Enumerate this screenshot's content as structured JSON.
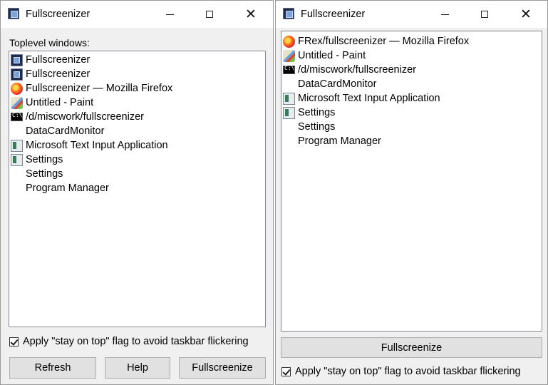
{
  "left_window": {
    "title": "Fullscreenizer",
    "list_label": "Toplevel windows:",
    "items": [
      {
        "icon": "fullscreenizer-icon",
        "label": "Fullscreenizer"
      },
      {
        "icon": "fullscreenizer-icon",
        "label": "Fullscreenizer"
      },
      {
        "icon": "firefox-icon",
        "label": "Fullscreenizer — Mozilla Firefox"
      },
      {
        "icon": "paint-icon",
        "label": "Untitled - Paint"
      },
      {
        "icon": "command-prompt-icon",
        "label": "/d/miscwork/fullscreenizer"
      },
      {
        "icon": "none",
        "label": "DataCardMonitor"
      },
      {
        "icon": "ms-app-icon",
        "label": "Microsoft Text Input Application"
      },
      {
        "icon": "ms-app-icon",
        "label": "Settings"
      },
      {
        "icon": "none",
        "label": "Settings"
      },
      {
        "icon": "none",
        "label": "Program Manager"
      }
    ],
    "checkbox_label": "Apply \"stay on top\" flag to avoid taskbar flickering",
    "checkbox_checked": true,
    "buttons": {
      "refresh": "Refresh",
      "help": "Help",
      "fullscreenize": "Fullscreenize"
    }
  },
  "right_window": {
    "title": "Fullscreenizer",
    "items": [
      {
        "icon": "firefox-icon",
        "label": "FRex/fullscreenizer — Mozilla Firefox"
      },
      {
        "icon": "paint-icon",
        "label": "Untitled - Paint"
      },
      {
        "icon": "command-prompt-icon",
        "label": "/d/miscwork/fullscreenizer"
      },
      {
        "icon": "none",
        "label": "DataCardMonitor"
      },
      {
        "icon": "ms-app-icon",
        "label": "Microsoft Text Input Application"
      },
      {
        "icon": "ms-app-icon",
        "label": "Settings"
      },
      {
        "icon": "none",
        "label": "Settings"
      },
      {
        "icon": "none",
        "label": "Program Manager"
      }
    ],
    "fullscreenize_button": "Fullscreenize",
    "checkbox_label": "Apply \"stay on top\" flag to avoid taskbar flickering",
    "checkbox_checked": true
  },
  "titlebar_buttons": {
    "minimize": "–",
    "maximize": "☐",
    "close": "✕"
  }
}
